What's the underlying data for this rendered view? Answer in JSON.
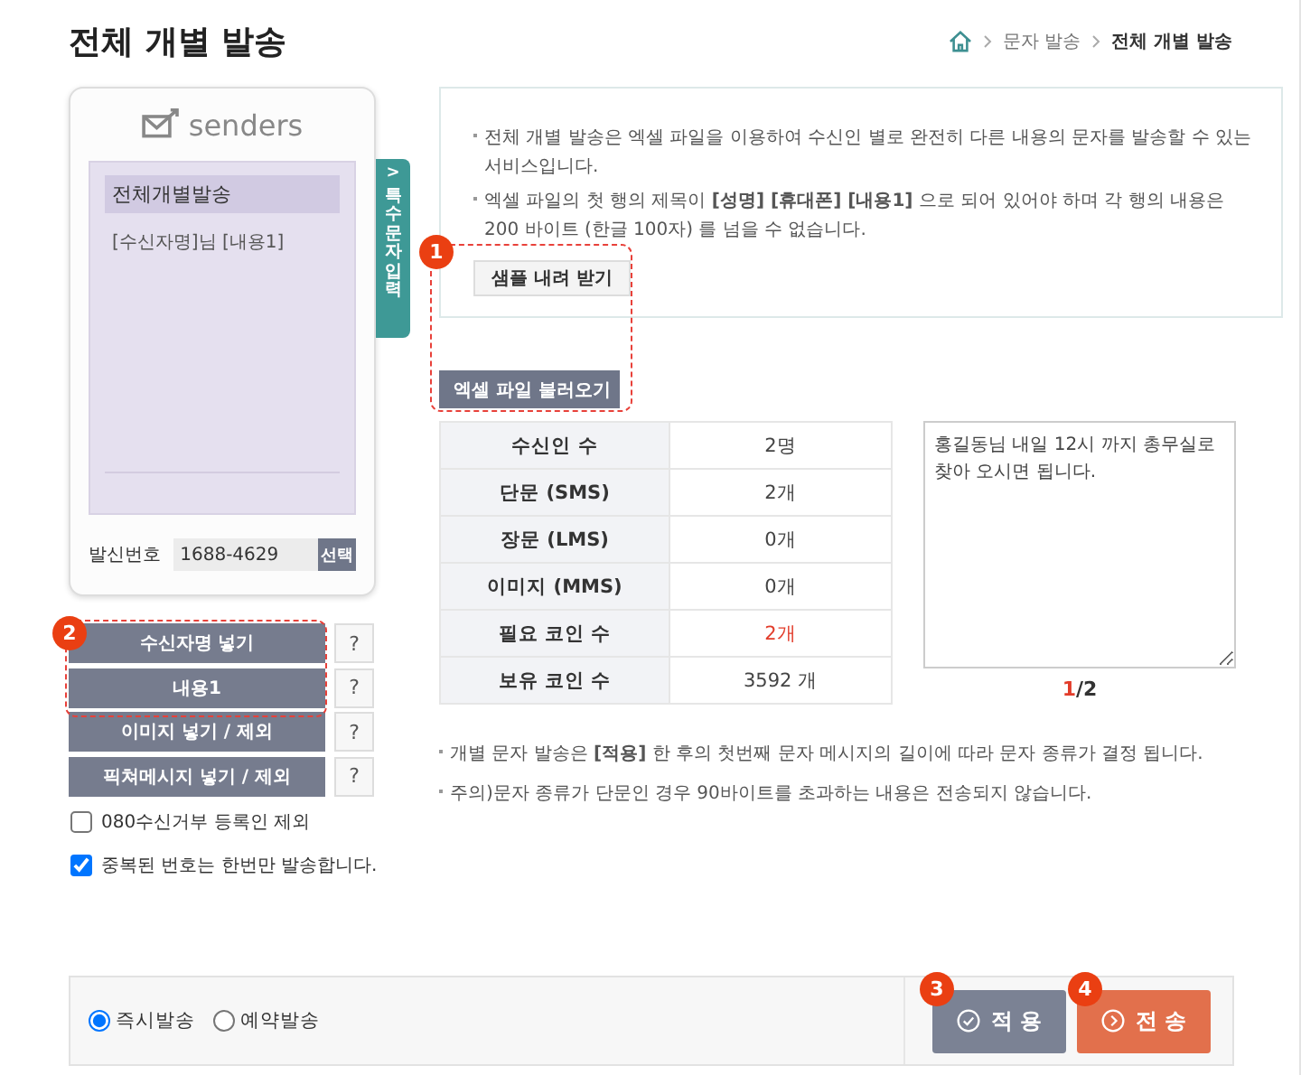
{
  "page_title": "전체 개별 발송",
  "breadcrumb": [
    "문자 발송",
    "전체 개별 발송"
  ],
  "phone": {
    "brand": "senders",
    "messages": [
      {
        "text": "전체개별발송",
        "selected": true
      },
      {
        "text": "[수신자명]님 [내용1]",
        "selected": false
      }
    ],
    "sender_label": "발신번호",
    "sender_number": "1688-4629",
    "select_button": "선택"
  },
  "special_char_tab": {
    "arrow": ">",
    "label": "특수문자 입력"
  },
  "insert_buttons": [
    {
      "label": "수신자명 넣기",
      "help": "?"
    },
    {
      "label": "내용1",
      "help": "?"
    },
    {
      "label": "이미지 넣기 / 제외",
      "help": "?"
    },
    {
      "label": "픽쳐메시지 넣기 / 제외",
      "help": "?"
    }
  ],
  "options": [
    {
      "label": "080수신거부 등록인 제외",
      "checked": false
    },
    {
      "label": "중복된 번호는 한번만 발송합니다.",
      "checked": true
    }
  ],
  "info": [
    "전체 개별 발송은 엑셀 파일을 이용하여 수신인 별로 완전히 다른 내용의 문자를 발송할 수 있는 서비스입니다.",
    "엑셀 파일의 첫 행의 제목이 **[성명] [휴대폰] [내용1]** 으로 되어 있어야 하며 각 행의 내용은 200 바이트 (한글 100자) 를 넘을 수 없습니다."
  ],
  "sample_button": "샘플 내려 받기",
  "excel_button": "엑셀 파일 불러오기",
  "summary": [
    {
      "label": "수신인 수",
      "value": "2명",
      "emphasis": false
    },
    {
      "label": "단문 (SMS)",
      "value": "2개",
      "emphasis": false
    },
    {
      "label": "장문 (LMS)",
      "value": "0개",
      "emphasis": false
    },
    {
      "label": "이미지 (MMS)",
      "value": "0개",
      "emphasis": false
    },
    {
      "label": "필요 코인 수",
      "value": "2개",
      "emphasis": true
    },
    {
      "label": "보유 코인 수",
      "value": "3592 개",
      "emphasis": false
    }
  ],
  "preview": {
    "value": "홍길동님 내일 12시 까지 총무실로 찾아 오시면 됩니다.",
    "current": "1",
    "rest": "/2"
  },
  "notes": [
    "개별 문자 발송은 **[적용]** 한 후의 첫번째 문자 메시지의 길이에 따라 문자 종류가 결정 됩니다.",
    "주의)문자 종류가 단문인 경우 90바이트를 초과하는 내용은 전송되지 않습니다."
  ],
  "send_modes": [
    {
      "label": "즉시발송",
      "selected": true
    },
    {
      "label": "예약발송",
      "selected": false
    }
  ],
  "actions": [
    {
      "kind": "apply",
      "label": "적 용"
    },
    {
      "kind": "send",
      "label": "전 송"
    }
  ],
  "annotations": [
    {
      "label": "1",
      "framed": true
    },
    {
      "label": "2",
      "framed": true
    },
    {
      "label": "3",
      "framed": false
    },
    {
      "label": "4",
      "framed": false
    }
  ]
}
